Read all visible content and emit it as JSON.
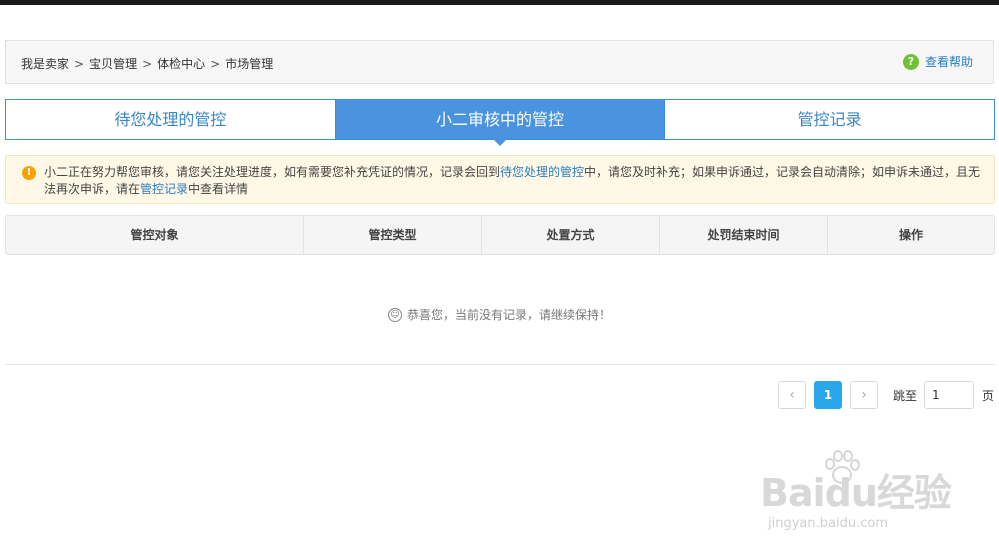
{
  "breadcrumb": {
    "items": [
      "我是卖家",
      "宝贝管理",
      "体检中心",
      "市场管理"
    ],
    "separator": ">"
  },
  "help": {
    "label": "查看帮助",
    "icon": "question-circle-icon"
  },
  "tabs": [
    {
      "label": "待您处理的管控",
      "active": false
    },
    {
      "label": "小二审核中的管控",
      "active": true
    },
    {
      "label": "管控记录",
      "active": false
    }
  ],
  "notice": {
    "icon": "warning-circle-icon",
    "text_1": "小二正在努力帮您审核，请您关注处理进度，如有需要您补充凭证的情况，记录会回到",
    "link_1": "待您处理的管控",
    "text_2": "中，请您及时补充；如果申诉通过，记录会自动清除；如申诉未通过，且无法再次申诉，请在",
    "link_2": "管控记录",
    "text_3": "中查看详情"
  },
  "table": {
    "columns": [
      "管控对象",
      "管控类型",
      "处置方式",
      "处罚结束时间",
      "操作"
    ]
  },
  "empty_state": {
    "icon": "smile-icon",
    "text": "恭喜您，当前没有记录，请继续保持！"
  },
  "pagination": {
    "prev": "‹",
    "current_page": "1",
    "next": "›",
    "jump_label": "跳至",
    "jump_value": "1",
    "page_unit": "页"
  },
  "watermark": {
    "logo": "Baidu经验",
    "url": "jingyan.baidu.com"
  },
  "colors": {
    "accent": "#4a93e0",
    "link": "#2a7dc4",
    "notice_bg": "#fff8e6",
    "pager_active": "#29a6ec",
    "help_icon": "#6fc234",
    "warning_icon": "#f4a300"
  }
}
